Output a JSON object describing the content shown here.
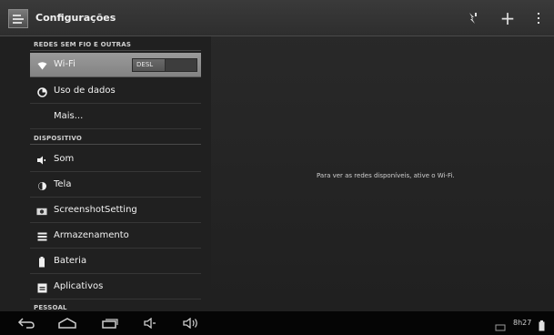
{
  "action_bar": {
    "title": "Configurações",
    "app_icon": "settings-app-icon",
    "actions": [
      "sync-icon",
      "add-icon",
      "overflow-menu-icon"
    ],
    "actions_symbols": {
      "add": "+"
    }
  },
  "sections": {
    "wireless": "REDES SEM FIO E OUTRAS",
    "device": "DISPOSITIVO",
    "personal": "PESSOAL"
  },
  "items": {
    "wifi": {
      "label": "Wi-Fi",
      "icon": "wifi-icon",
      "toggle_state": "DESL"
    },
    "data_usage": {
      "label": "Uso de dados",
      "icon": "data-usage-icon"
    },
    "more": {
      "label": "Mais..."
    },
    "sound": {
      "label": "Som",
      "icon": "speaker-icon"
    },
    "display": {
      "label": "Tela",
      "icon": "brightness-icon"
    },
    "screenshot": {
      "label": "ScreenshotSetting",
      "icon": "camera-icon"
    },
    "storage": {
      "label": "Armazenamento",
      "icon": "storage-icon"
    },
    "battery": {
      "label": "Bateria",
      "icon": "battery-icon"
    },
    "apps": {
      "label": "Aplicativos",
      "icon": "apps-icon"
    }
  },
  "content": {
    "wifi_message": "Para ver as redes disponíveis, ative o Wi-Fi."
  },
  "nav_bar": {
    "buttons": [
      "back-icon",
      "home-icon",
      "recent-apps-icon",
      "volume-down-icon",
      "volume-up-icon"
    ]
  },
  "status_bar": {
    "time": "8h27",
    "icons": [
      "screenshot-icon",
      "battery-icon"
    ]
  },
  "colors": {
    "active_item": "#8f8f8f",
    "background": "#242424",
    "navbar": "#050505"
  }
}
